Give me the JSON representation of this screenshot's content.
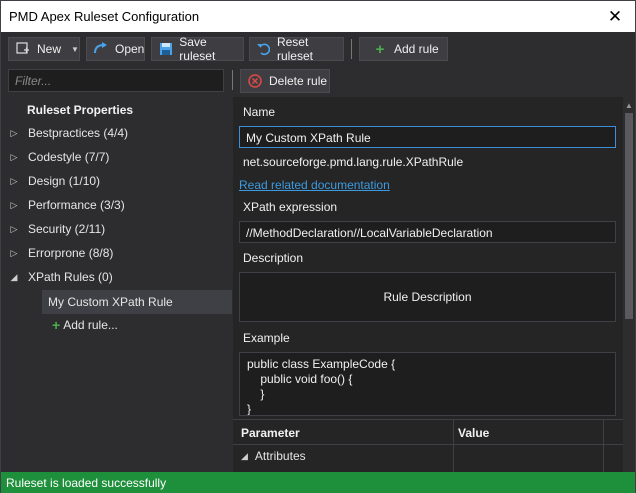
{
  "window": {
    "title": "PMD Apex Ruleset Configuration"
  },
  "toolbar": {
    "new_label": "New",
    "open_label": "Open",
    "save_label": "Save ruleset",
    "reset_label": "Reset ruleset",
    "add_rule_label": "Add rule",
    "delete_rule_label": "Delete rule"
  },
  "filter": {
    "placeholder": "Filter..."
  },
  "tree": {
    "header": "Ruleset Properties",
    "items": [
      {
        "label": "Bestpractices (4/4)"
      },
      {
        "label": "Codestyle (7/7)"
      },
      {
        "label": "Design (1/10)"
      },
      {
        "label": "Performance (3/3)"
      },
      {
        "label": "Security (2/11)"
      },
      {
        "label": "Errorprone (8/8)"
      },
      {
        "label": "XPath Rules (0)"
      }
    ],
    "selected_child": "My Custom XPath Rule",
    "add_rule": "Add rule..."
  },
  "detail": {
    "name_label": "Name",
    "name_value": "My Custom XPath Rule",
    "class_name": "net.sourceforge.pmd.lang.rule.XPathRule",
    "doc_link": "Read related documentation",
    "xpath_label": "XPath expression",
    "xpath_value": "//MethodDeclaration//LocalVariableDeclaration",
    "description_label": "Description",
    "description_value": "Rule Description",
    "example_label": "Example",
    "example_lines": [
      "public class ExampleCode {",
      "    public void foo() {",
      "    }",
      "}"
    ]
  },
  "grid": {
    "col_parameter": "Parameter",
    "col_value": "Value",
    "row_attributes": "Attributes"
  },
  "status": {
    "text": "Ruleset is loaded successfully"
  },
  "colors": {
    "status_bg": "#1e8f3a",
    "link": "#3c9be0",
    "accent_border": "#3c8fd8"
  }
}
